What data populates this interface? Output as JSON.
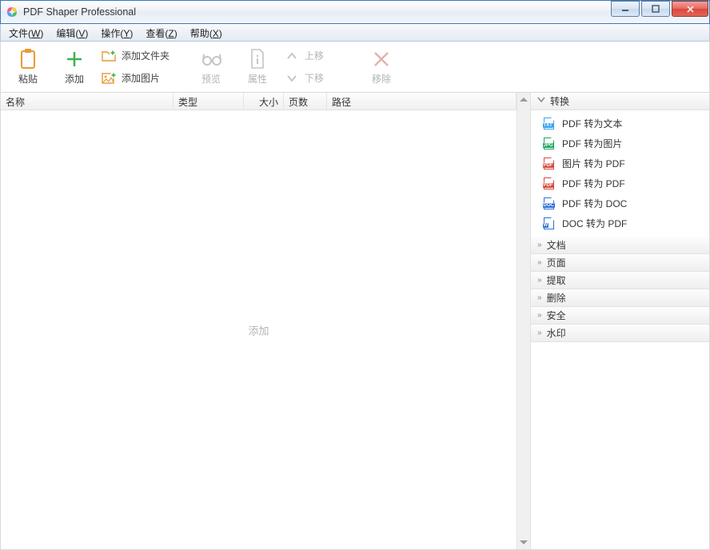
{
  "window": {
    "title": "PDF Shaper Professional"
  },
  "menu": {
    "file": {
      "label": "文件",
      "key": "W"
    },
    "edit": {
      "label": "编辑",
      "key": "V"
    },
    "operate": {
      "label": "操作",
      "key": "Y"
    },
    "view": {
      "label": "查看",
      "key": "Z"
    },
    "help": {
      "label": "帮助",
      "key": "X"
    }
  },
  "toolbar": {
    "paste": "粘贴",
    "add": "添加",
    "add_folder": "添加文件夹",
    "add_image": "添加图片",
    "preview": "预览",
    "properties": "属性",
    "move_up": "上移",
    "move_down": "下移",
    "remove": "移除"
  },
  "columns": {
    "name": "名称",
    "type": "类型",
    "size": "大小",
    "pages": "页数",
    "path": "路径"
  },
  "list": {
    "placeholder": "添加"
  },
  "side": {
    "sections": {
      "convert": {
        "label": "转换",
        "expanded": true,
        "items": [
          {
            "label": "PDF 转为文本",
            "tag": "TXT",
            "color": "#3aa3f0"
          },
          {
            "label": "PDF 转为图片",
            "tag": "JPG",
            "color": "#1fa561"
          },
          {
            "label": "图片 转为 PDF",
            "tag": "PDF",
            "color": "#d64a3f"
          },
          {
            "label": "PDF 转为 PDF",
            "tag": "PDF",
            "color": "#d64a3f"
          },
          {
            "label": "PDF 转为 DOC",
            "tag": "DOC",
            "color": "#2b6fd6"
          },
          {
            "label": "DOC 转为 PDF",
            "tag": "W",
            "color": "#2b6fd6"
          }
        ]
      },
      "document": {
        "label": "文档"
      },
      "page": {
        "label": "页面"
      },
      "extract": {
        "label": "提取"
      },
      "delete": {
        "label": "删除"
      },
      "security": {
        "label": "安全"
      },
      "watermark": {
        "label": "水印"
      }
    }
  }
}
